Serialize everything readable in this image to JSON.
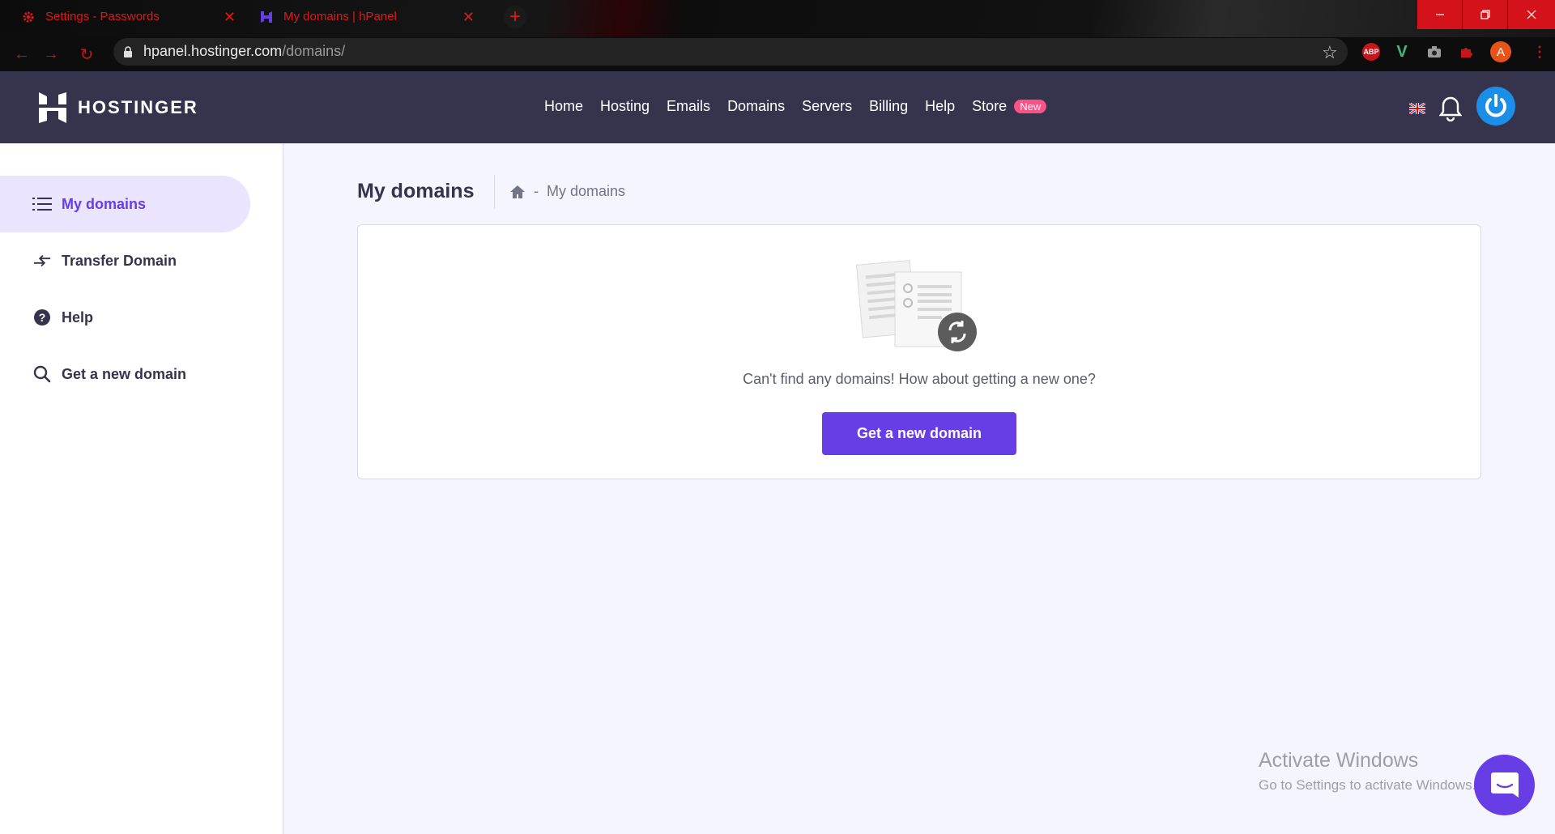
{
  "browser": {
    "tabs": [
      {
        "title": "Settings - Passwords",
        "icon": "gear-icon",
        "active": false
      },
      {
        "title": "My domains | hPanel",
        "icon": "hostinger-h-icon",
        "active": true
      }
    ],
    "new_tab_symbol": "+",
    "url_host": "hpanel.hostinger.com",
    "url_path": "/domains/",
    "window_controls": [
      "minimize",
      "restore",
      "close"
    ],
    "extensions": [
      {
        "name": "adblock-plus-icon",
        "label": "ABP"
      },
      {
        "name": "vue-devtools-icon",
        "label": "V"
      },
      {
        "name": "camera-icon",
        "label": ""
      },
      {
        "name": "puzzle-extension-icon",
        "label": ""
      },
      {
        "name": "profile-avatar",
        "label": "A"
      }
    ],
    "accent": "#e0181b"
  },
  "header": {
    "logo_text": "HOSTINGER",
    "nav": [
      {
        "label": "Home"
      },
      {
        "label": "Hosting"
      },
      {
        "label": "Emails"
      },
      {
        "label": "Domains"
      },
      {
        "label": "Servers"
      },
      {
        "label": "Billing"
      },
      {
        "label": "Help"
      },
      {
        "label": "Store",
        "badge": "New"
      }
    ],
    "language": "uk-flag-icon",
    "background": "#36344d"
  },
  "sidebar": {
    "items": [
      {
        "label": "My domains",
        "icon": "list-icon",
        "active": true
      },
      {
        "label": "Transfer Domain",
        "icon": "transfer-arrows-icon",
        "active": false
      },
      {
        "label": "Help",
        "icon": "question-circle-icon",
        "active": false
      },
      {
        "label": "Get a new domain",
        "icon": "search-icon",
        "active": false
      }
    ]
  },
  "main": {
    "title": "My domains",
    "breadcrumb": {
      "home_icon": "home-icon",
      "separator": "-",
      "current": "My domains"
    },
    "empty_state": {
      "illustration": "documents-sync-illustration",
      "message": "Can't find any domains! How about getting a new one?",
      "button_label": "Get a new domain"
    }
  },
  "os_watermark": {
    "line1": "Activate Windows",
    "line2": "Go to Settings to activate Windows."
  },
  "colors": {
    "primary": "#673de6",
    "active_bg": "#ebe4ff",
    "badge": "#fc5185"
  }
}
